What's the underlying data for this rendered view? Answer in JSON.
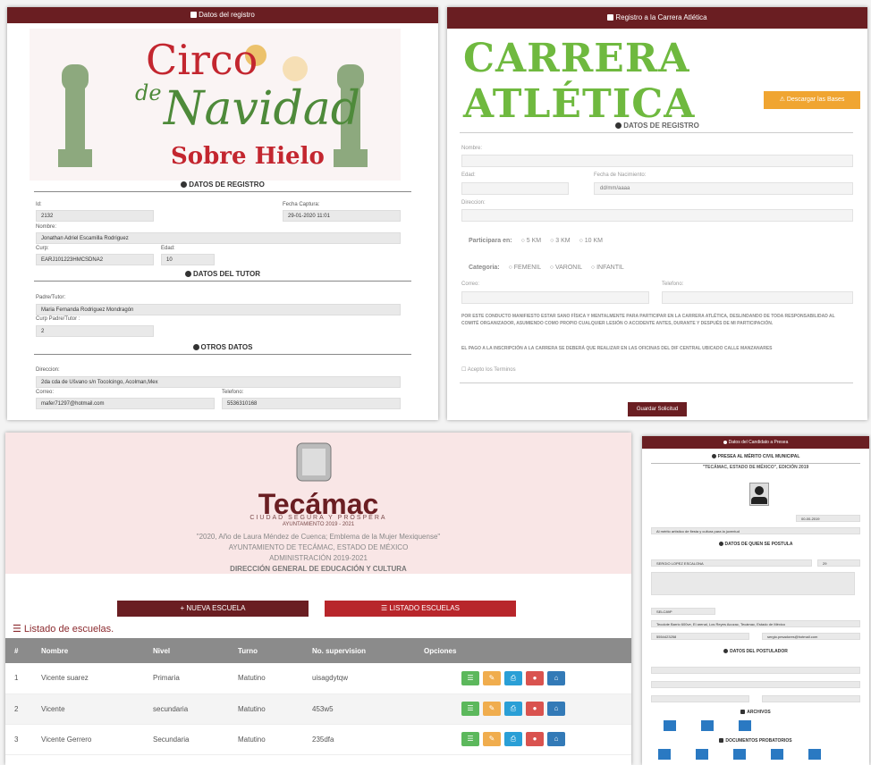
{
  "registro": {
    "header": "Datos del registro",
    "banner": {
      "line1": "Circo",
      "line2": "de",
      "line3": "Navidad",
      "line4": "Sobre Hielo"
    },
    "section_registro": "DATOS DE REGISTRO",
    "id_label": "Id:",
    "id_value": "2132",
    "fecha_label": "Fecha Captura:",
    "fecha_value": "29-01-2020 11:01",
    "nombre_label": "Nombre:",
    "nombre_value": "Jonathan Adriel Escamilla Rodriguez",
    "curp_label": "Curp:",
    "curp_value": "EARJ101223HMCSDNA2",
    "edad_label": "Edad:",
    "edad_value": "10",
    "section_tutor": "DATOS DEL TUTOR",
    "padre_label": "Padre/Tutor:",
    "padre_value": "Maria Fernanda Rodriguez Mondragón",
    "curp_padre_label": "Curp Padre/Tutor :",
    "curp_padre_value": "2",
    "section_otros": "OTROS DATOS",
    "direccion_label": "Direccion:",
    "direccion_value": "2da cda de Ušvano s/n Tocolcingo, Acolman,Mex",
    "correo_label": "Correo:",
    "correo_value": "mafer71297@hotmail.com",
    "telefono_label": "Telefono:",
    "telefono_value": "5536310168"
  },
  "carrera": {
    "header": "Registro a la Carrera Atlética",
    "title": "CARRERA ATLÉTICA",
    "upload_button": "Descargar las Bases",
    "section": "DATOS DE REGISTRO",
    "nombre_label": "Nombre:",
    "edad_label": "Edad:",
    "fecha_label": "Fecha de Nacimiento:",
    "fecha_value": "dd/mm/aaaa",
    "direccion_label": "Direccion:",
    "participa_label": "Participara en:",
    "participa_options": [
      "5 KM",
      "3 KM",
      "10 KM"
    ],
    "categoria_label": "Categoria:",
    "categoria_options": [
      "FEMENIL",
      "VARONIL",
      "INFANTIL"
    ],
    "correo_label": "Correo:",
    "telefono_label": "Telefono:",
    "terms_text": "POR ESTE CONDUCTO MANIFIESTO ESTAR SANO FÍSICA Y MENTALMENTE PARA PARTICIPAR EN LA CARRERA ATLÉTICA, DESLINDANDO DE TODA RESPONSABILIDAD AL COMITÉ ORGANIZADOR, ASUMIENDO COMO PROPIO CUALQUIER LESIÓN O ACCIDENTE ANTES, DURANTE Y DESPUÉS DE MI PARTICIPACIÓN.",
    "payment_text": "EL PAGO A LA INSCRIPCIÓN A LA CARRERA SE DEBERÁ QUE REALIZAR EN LAS OFICINAS DEL DIF CENTRAL UBICADO CALLE MANZANARES",
    "accept_label": "Acepto los Terminos",
    "submit_button": "Guardar Solicitud"
  },
  "escuelas": {
    "logo_name": "Tecámac",
    "logo_sub": "CIUDAD SEGURA Y PRÓSPERA",
    "logo_years": "AYUNTAMIENTO 2019 - 2021",
    "motto": "\"2020, Año de Laura Méndez de Cuenca; Emblema de la Mujer Mexiquense\"",
    "ayuntamiento": "AYUNTAMIENTO DE TECÁMAC, ESTADO DE MÉXICO",
    "administracion": "ADMINISTRACIÓN 2019-2021",
    "direccion": "DIRECCIÓN GENERAL DE EDUCACIÓN Y CULTURA",
    "new_button": "+ NUEVA ESCUELA",
    "list_button": "LISTADO ESCUELAS",
    "list_title": "Listado de escuelas.",
    "columns": [
      "#",
      "Nombre",
      "Nivel",
      "Turno",
      "No. supervision",
      "Opciones"
    ],
    "rows": [
      [
        "1",
        "Vicente suarez",
        "Primaria",
        "Matutino",
        "uisagdytqw"
      ],
      [
        "2",
        "Vicente",
        "secundaria",
        "Matutino",
        "453w5"
      ],
      [
        "3",
        "Vicente Gerrero",
        "Secundaria",
        "Matutino",
        "235dfa"
      ]
    ],
    "colors": {
      "green": "#5cb85c",
      "orange": "#f0ad4e",
      "blue": "#2a9fd6",
      "red": "#d9534f",
      "dark_blue": "#337ab7"
    }
  },
  "candidato": {
    "header": "Datos del Candidato a Presea",
    "presea": "PRESEA AL MÉRITO CIVIL MUNICIPAL",
    "edicion": "\"TECÁMAC, ESTADO DE MÉXICO\", EDICIÓN 2019",
    "fecha_value": "00-00-2019",
    "categoria_value": "Al mérito artístico de fiesta y cultura para la juventud",
    "section_postula": "DATOS DE QUIEN SE POSTULA",
    "nombre_value": "SERGIO LOPEZ ESCALONA",
    "edad_value": "29",
    "curp_value": "SELC89P",
    "direccion_value": "Tecolote Barrio 600ve, El arenal, Los Reyes Acozac, Tecámac, Estado de México",
    "telefono_value": "5554423258",
    "correo_value": "sergio.pesadores@hotmail.com",
    "section_postulador": "DATOS DEL POSTULADOR",
    "section_archivos": "ARCHIVOS",
    "section_docs": "DOCUMENTOS PROBATORIOS"
  }
}
